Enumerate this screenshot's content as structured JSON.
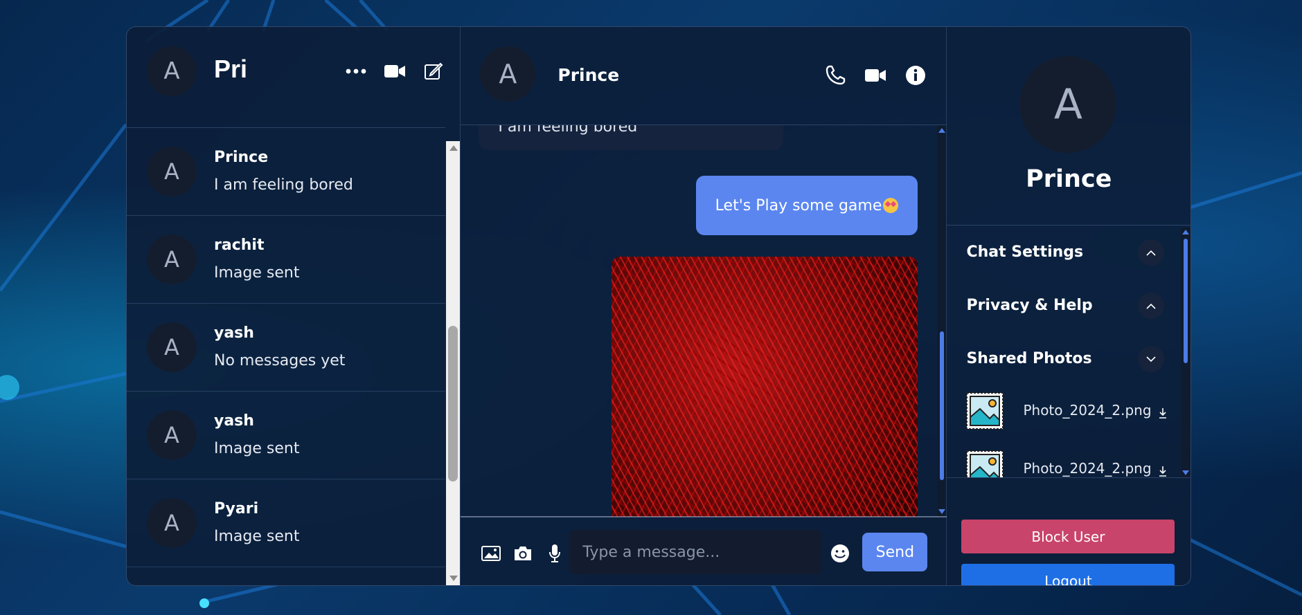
{
  "sidebar": {
    "avatar_letter": "A",
    "title": "Pri",
    "icons": [
      "more-icon",
      "video-call-icon",
      "compose-icon"
    ],
    "conversations": [
      {
        "avatar": "A",
        "name": "Prince",
        "last_message": "I am feeling bored"
      },
      {
        "avatar": "A",
        "name": "rachit",
        "last_message": "Image sent"
      },
      {
        "avatar": "A",
        "name": "yash",
        "last_message": "No messages yet"
      },
      {
        "avatar": "A",
        "name": "yash",
        "last_message": "Image sent"
      },
      {
        "avatar": "A",
        "name": "Pyari",
        "last_message": "Image sent"
      }
    ]
  },
  "chat": {
    "avatar_letter": "A",
    "contact_name": "Prince",
    "icons": [
      "phone-icon",
      "video-call-icon",
      "info-icon"
    ],
    "messages": [
      {
        "type": "received",
        "text": "I am feeling bored"
      },
      {
        "type": "sent",
        "text": "Let's Play some game"
      },
      {
        "type": "sent-image"
      }
    ],
    "composer": {
      "placeholder": "Type a message...",
      "send_label": "Send"
    }
  },
  "details": {
    "avatar_letter": "A",
    "name": "Prince",
    "sections": [
      {
        "label": "Chat Settings",
        "state": "collapsed"
      },
      {
        "label": "Privacy & Help",
        "state": "collapsed"
      },
      {
        "label": "Shared Photos",
        "state": "expanded"
      }
    ],
    "photos": [
      {
        "filename": "Photo_2024_2.png"
      },
      {
        "filename": "Photo_2024_2.png"
      }
    ],
    "block_label": "Block User",
    "logout_label": "Logout"
  },
  "colors": {
    "accent": "#5b86f0",
    "block": "#c8446a",
    "logout": "#1e6fe6",
    "panel": "#0c1e3a"
  }
}
